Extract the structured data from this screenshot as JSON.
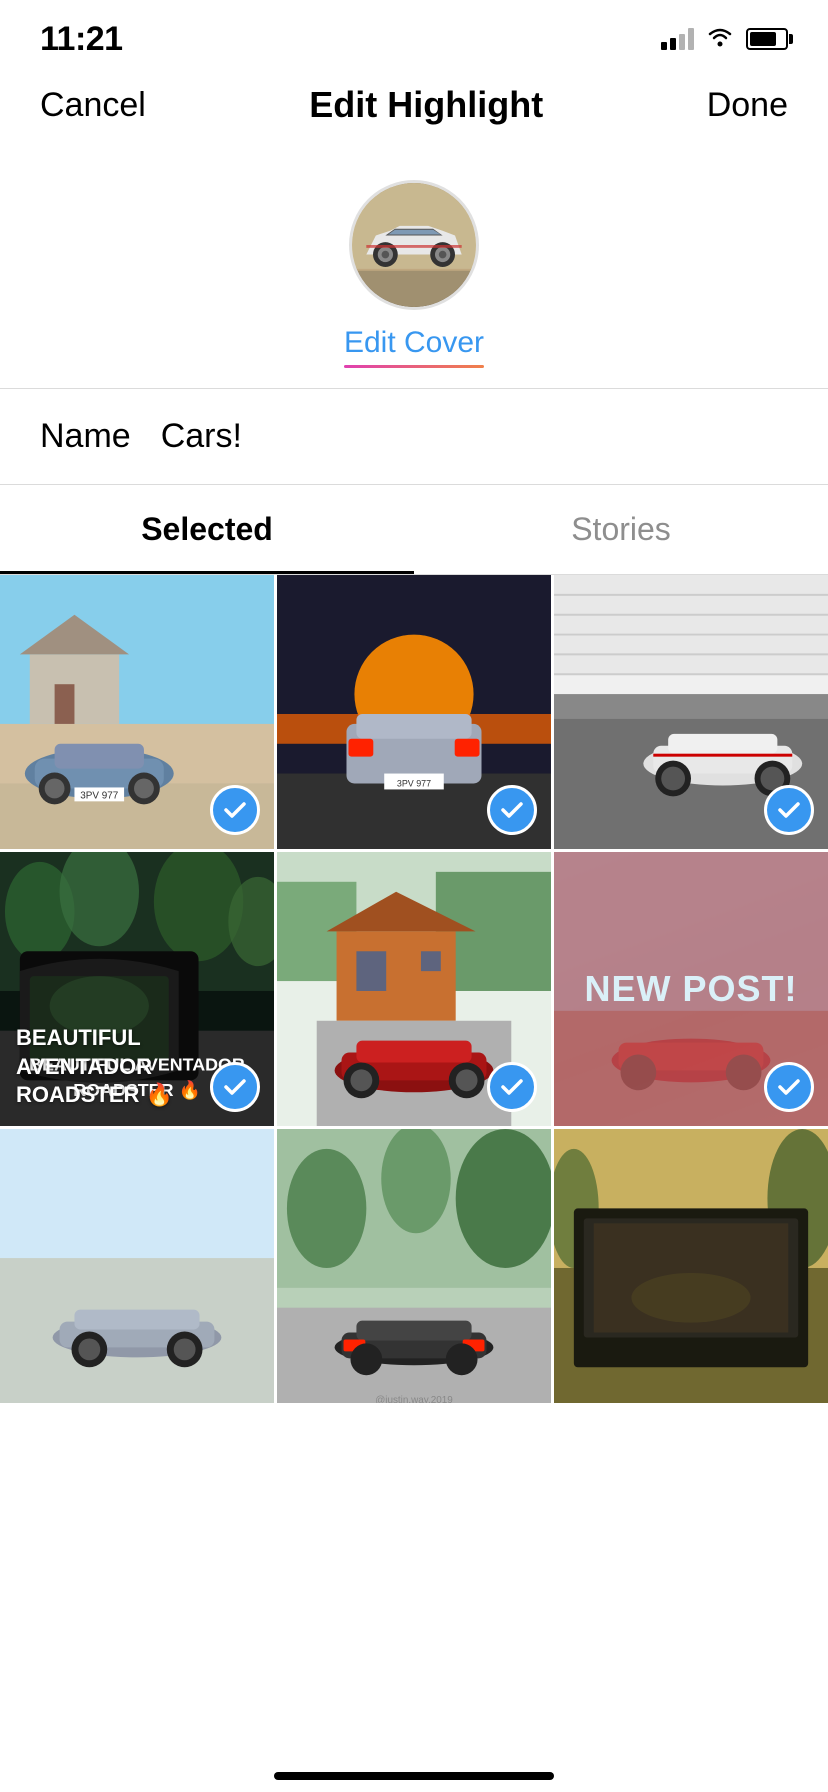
{
  "statusBar": {
    "time": "11:21",
    "locationIcon": "►",
    "wifiLevel": 3,
    "batteryPercent": 75
  },
  "nav": {
    "cancelLabel": "Cancel",
    "titleLabel": "Edit Highlight",
    "doneLabel": "Done"
  },
  "cover": {
    "editCoverLabel": "Edit Cover"
  },
  "nameRow": {
    "nameLabel": "Name",
    "nameValue": "Cars!"
  },
  "tabs": [
    {
      "id": "selected",
      "label": "Selected",
      "active": true
    },
    {
      "id": "stories",
      "label": "Stories",
      "active": false
    }
  ],
  "photos": [
    {
      "id": 1,
      "checked": true,
      "type": "beach-car",
      "overlayText": ""
    },
    {
      "id": 2,
      "checked": true,
      "type": "sunset-car",
      "overlayText": ""
    },
    {
      "id": 3,
      "checked": true,
      "type": "track-car",
      "overlayText": ""
    },
    {
      "id": 4,
      "checked": true,
      "type": "road-mirror",
      "overlayText": "BEAUTIFUL AVENTADOR\nROADSTER 🔥"
    },
    {
      "id": 5,
      "checked": true,
      "type": "red-car-house",
      "overlayText": ""
    },
    {
      "id": 6,
      "checked": true,
      "type": "new-post",
      "overlayText": "NEW POST!"
    },
    {
      "id": 7,
      "checked": false,
      "type": "sky-car",
      "overlayText": ""
    },
    {
      "id": 8,
      "checked": false,
      "type": "car-trees",
      "overlayText": ""
    },
    {
      "id": 9,
      "checked": false,
      "type": "car-road",
      "overlayText": ""
    }
  ],
  "checkIcon": "✓"
}
